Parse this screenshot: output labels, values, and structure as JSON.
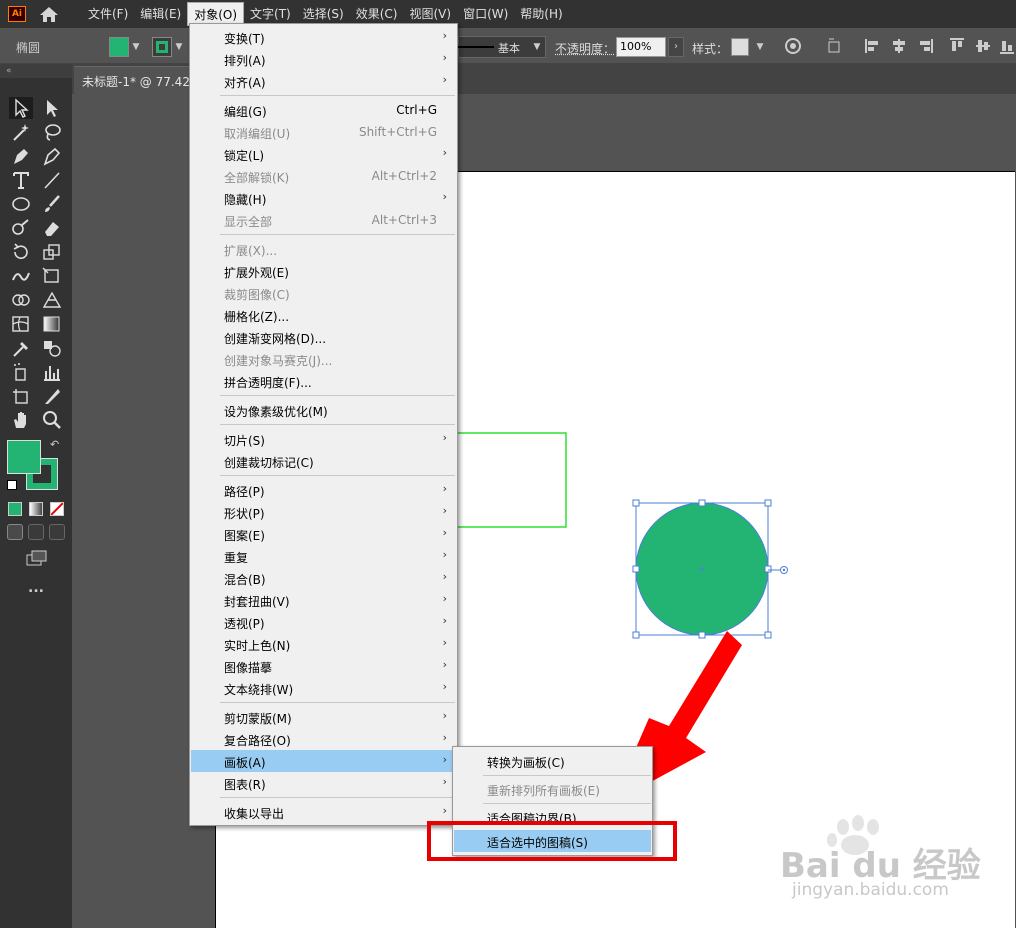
{
  "app": {
    "logo": "Ai"
  },
  "menubar": {
    "items": [
      "文件(F)",
      "编辑(E)",
      "对象(O)",
      "文字(T)",
      "选择(S)",
      "效果(C)",
      "视图(V)",
      "窗口(W)",
      "帮助(H)"
    ],
    "active_index": 2
  },
  "controlbar": {
    "shape_name": "椭圆",
    "fill_color": "#23b473",
    "stroke_color": "#23b473",
    "stroke_profile": "基本",
    "opacity_label": "不透明度：",
    "opacity_value": "100%",
    "style_label": "样式："
  },
  "document": {
    "tab_title": "未标题-1* @ 77.42"
  },
  "toolbar": {
    "fill_color": "#23b473",
    "stroke_color": "#23b473",
    "more_label": "..."
  },
  "object_menu": {
    "items": [
      {
        "label": "变换(T)",
        "submenu": true
      },
      {
        "label": "排列(A)",
        "submenu": true
      },
      {
        "label": "对齐(A)",
        "submenu": true
      },
      {
        "label": "编组(G)",
        "shortcut": "Ctrl+G"
      },
      {
        "label": "取消编组(U)",
        "shortcut": "Shift+Ctrl+G",
        "disabled": true
      },
      {
        "label": "锁定(L)",
        "submenu": true
      },
      {
        "label": "全部解锁(K)",
        "shortcut": "Alt+Ctrl+2",
        "disabled": true
      },
      {
        "label": "隐藏(H)",
        "submenu": true
      },
      {
        "label": "显示全部",
        "shortcut": "Alt+Ctrl+3",
        "disabled": true
      },
      {
        "label": "扩展(X)...",
        "disabled": true
      },
      {
        "label": "扩展外观(E)"
      },
      {
        "label": "裁剪图像(C)",
        "disabled": true
      },
      {
        "label": "栅格化(Z)..."
      },
      {
        "label": "创建渐变网格(D)..."
      },
      {
        "label": "创建对象马赛克(J)...",
        "disabled": true
      },
      {
        "label": "拼合透明度(F)..."
      },
      {
        "label": "设为像素级优化(M)"
      },
      {
        "label": "切片(S)",
        "submenu": true
      },
      {
        "label": "创建裁切标记(C)"
      },
      {
        "label": "路径(P)",
        "submenu": true
      },
      {
        "label": "形状(P)",
        "submenu": true
      },
      {
        "label": "图案(E)",
        "submenu": true
      },
      {
        "label": "重复",
        "submenu": true
      },
      {
        "label": "混合(B)",
        "submenu": true
      },
      {
        "label": "封套扭曲(V)",
        "submenu": true
      },
      {
        "label": "透视(P)",
        "submenu": true
      },
      {
        "label": "实时上色(N)",
        "submenu": true
      },
      {
        "label": "图像描摹",
        "submenu": true
      },
      {
        "label": "文本绕排(W)",
        "submenu": true
      },
      {
        "label": "剪切蒙版(M)",
        "submenu": true
      },
      {
        "label": "复合路径(O)",
        "submenu": true
      },
      {
        "label": "画板(A)",
        "submenu": true,
        "highlighted": true
      },
      {
        "label": "图表(R)",
        "submenu": true
      },
      {
        "label": "收集以导出",
        "submenu": true
      }
    ]
  },
  "artboard_submenu": {
    "items": [
      {
        "label": "转换为画板(C)"
      },
      {
        "label": "重新排列所有画板(E)",
        "disabled": true
      },
      {
        "label": "适合图稿边界(B)"
      },
      {
        "label": "适合选中的图稿(S)",
        "highlighted": true
      }
    ]
  },
  "canvas": {
    "rect_stroke_color": "#2ee02e",
    "circle_fill": "#23b473",
    "selection_color": "#4a7fd6",
    "arrow_color": "#ff0000"
  },
  "watermark": {
    "brand": "Bai du 经验",
    "url": "jingyan.baidu.com"
  }
}
